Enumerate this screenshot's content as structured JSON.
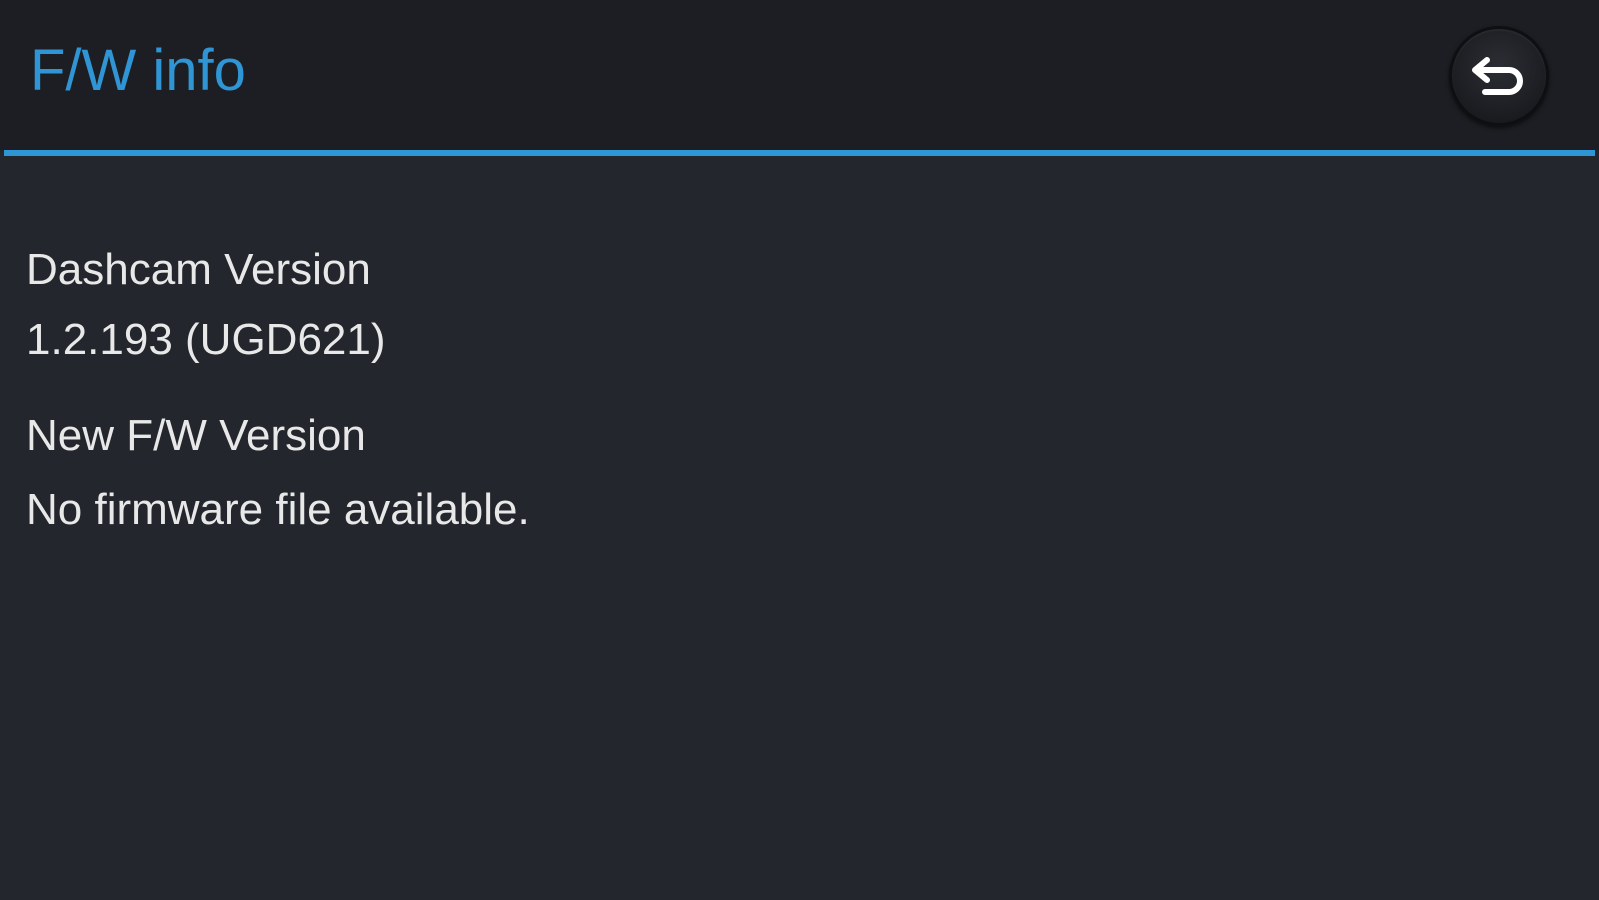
{
  "header": {
    "title": "F/W info",
    "back_icon": "back-arrow-icon",
    "accent_color": "#2f95d4"
  },
  "info": {
    "dashcam_version_label": "Dashcam Version",
    "dashcam_version_value": "1.2.193 (UGD621)",
    "new_fw_label": "New F/W Version",
    "new_fw_value": "No firmware file available."
  }
}
